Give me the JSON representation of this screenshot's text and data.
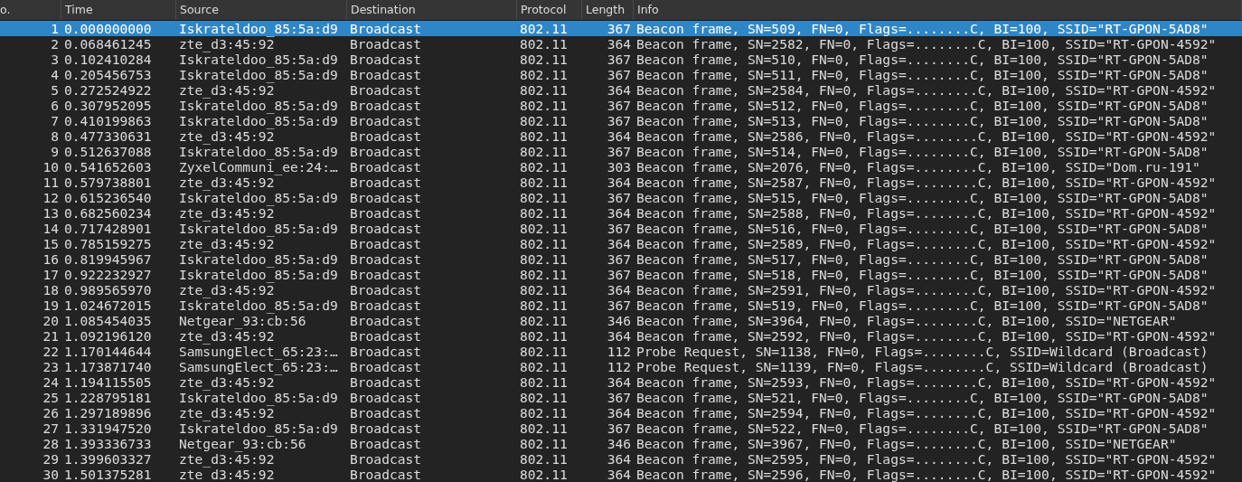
{
  "table": {
    "columns": [
      "o.",
      "Time",
      "Source",
      "Destination",
      "Protocol",
      "Length",
      "Info"
    ],
    "rows": [
      {
        "no": "1",
        "time": "0.000000000",
        "source": "Iskrateldoo_85:5a:d9",
        "destination": "Broadcast",
        "protocol": "802.11",
        "length": "367",
        "info": "Beacon frame, SN=509, FN=0, Flags=........C, BI=100, SSID=\"RT-GPON-5AD8\"",
        "selected": true
      },
      {
        "no": "2",
        "time": "0.068461245",
        "source": "zte_d3:45:92",
        "destination": "Broadcast",
        "protocol": "802.11",
        "length": "364",
        "info": "Beacon frame, SN=2582, FN=0, Flags=........C, BI=100, SSID=\"RT-GPON-4592\"",
        "selected": false
      },
      {
        "no": "3",
        "time": "0.102410284",
        "source": "Iskrateldoo_85:5a:d9",
        "destination": "Broadcast",
        "protocol": "802.11",
        "length": "367",
        "info": "Beacon frame, SN=510, FN=0, Flags=........C, BI=100, SSID=\"RT-GPON-5AD8\"",
        "selected": false
      },
      {
        "no": "4",
        "time": "0.205456753",
        "source": "Iskrateldoo_85:5a:d9",
        "destination": "Broadcast",
        "protocol": "802.11",
        "length": "367",
        "info": "Beacon frame, SN=511, FN=0, Flags=........C, BI=100, SSID=\"RT-GPON-5AD8\"",
        "selected": false
      },
      {
        "no": "5",
        "time": "0.272524922",
        "source": "zte_d3:45:92",
        "destination": "Broadcast",
        "protocol": "802.11",
        "length": "364",
        "info": "Beacon frame, SN=2584, FN=0, Flags=........C, BI=100, SSID=\"RT-GPON-4592\"",
        "selected": false
      },
      {
        "no": "6",
        "time": "0.307952095",
        "source": "Iskrateldoo_85:5a:d9",
        "destination": "Broadcast",
        "protocol": "802.11",
        "length": "367",
        "info": "Beacon frame, SN=512, FN=0, Flags=........C, BI=100, SSID=\"RT-GPON-5AD8\"",
        "selected": false
      },
      {
        "no": "7",
        "time": "0.410199863",
        "source": "Iskrateldoo_85:5a:d9",
        "destination": "Broadcast",
        "protocol": "802.11",
        "length": "367",
        "info": "Beacon frame, SN=513, FN=0, Flags=........C, BI=100, SSID=\"RT-GPON-5AD8\"",
        "selected": false
      },
      {
        "no": "8",
        "time": "0.477330631",
        "source": "zte_d3:45:92",
        "destination": "Broadcast",
        "protocol": "802.11",
        "length": "364",
        "info": "Beacon frame, SN=2586, FN=0, Flags=........C, BI=100, SSID=\"RT-GPON-4592\"",
        "selected": false
      },
      {
        "no": "9",
        "time": "0.512637088",
        "source": "Iskrateldoo_85:5a:d9",
        "destination": "Broadcast",
        "protocol": "802.11",
        "length": "367",
        "info": "Beacon frame, SN=514, FN=0, Flags=........C, BI=100, SSID=\"RT-GPON-5AD8\"",
        "selected": false
      },
      {
        "no": "10",
        "time": "0.541652603",
        "source": "ZyxelCommuni_ee:24:…",
        "destination": "Broadcast",
        "protocol": "802.11",
        "length": "303",
        "info": "Beacon frame, SN=2076, FN=0, Flags=........C, BI=100, SSID=\"Dom.ru-191\"",
        "selected": false
      },
      {
        "no": "11",
        "time": "0.579738801",
        "source": "zte_d3:45:92",
        "destination": "Broadcast",
        "protocol": "802.11",
        "length": "364",
        "info": "Beacon frame, SN=2587, FN=0, Flags=........C, BI=100, SSID=\"RT-GPON-4592\"",
        "selected": false
      },
      {
        "no": "12",
        "time": "0.615236540",
        "source": "Iskrateldoo_85:5a:d9",
        "destination": "Broadcast",
        "protocol": "802.11",
        "length": "367",
        "info": "Beacon frame, SN=515, FN=0, Flags=........C, BI=100, SSID=\"RT-GPON-5AD8\"",
        "selected": false
      },
      {
        "no": "13",
        "time": "0.682560234",
        "source": "zte_d3:45:92",
        "destination": "Broadcast",
        "protocol": "802.11",
        "length": "364",
        "info": "Beacon frame, SN=2588, FN=0, Flags=........C, BI=100, SSID=\"RT-GPON-4592\"",
        "selected": false
      },
      {
        "no": "14",
        "time": "0.717428901",
        "source": "Iskrateldoo_85:5a:d9",
        "destination": "Broadcast",
        "protocol": "802.11",
        "length": "367",
        "info": "Beacon frame, SN=516, FN=0, Flags=........C, BI=100, SSID=\"RT-GPON-5AD8\"",
        "selected": false
      },
      {
        "no": "15",
        "time": "0.785159275",
        "source": "zte_d3:45:92",
        "destination": "Broadcast",
        "protocol": "802.11",
        "length": "364",
        "info": "Beacon frame, SN=2589, FN=0, Flags=........C, BI=100, SSID=\"RT-GPON-4592\"",
        "selected": false
      },
      {
        "no": "16",
        "time": "0.819945967",
        "source": "Iskrateldoo_85:5a:d9",
        "destination": "Broadcast",
        "protocol": "802.11",
        "length": "367",
        "info": "Beacon frame, SN=517, FN=0, Flags=........C, BI=100, SSID=\"RT-GPON-5AD8\"",
        "selected": false
      },
      {
        "no": "17",
        "time": "0.922232927",
        "source": "Iskrateldoo_85:5a:d9",
        "destination": "Broadcast",
        "protocol": "802.11",
        "length": "367",
        "info": "Beacon frame, SN=518, FN=0, Flags=........C, BI=100, SSID=\"RT-GPON-5AD8\"",
        "selected": false
      },
      {
        "no": "18",
        "time": "0.989565970",
        "source": "zte_d3:45:92",
        "destination": "Broadcast",
        "protocol": "802.11",
        "length": "364",
        "info": "Beacon frame, SN=2591, FN=0, Flags=........C, BI=100, SSID=\"RT-GPON-4592\"",
        "selected": false
      },
      {
        "no": "19",
        "time": "1.024672015",
        "source": "Iskrateldoo_85:5a:d9",
        "destination": "Broadcast",
        "protocol": "802.11",
        "length": "367",
        "info": "Beacon frame, SN=519, FN=0, Flags=........C, BI=100, SSID=\"RT-GPON-5AD8\"",
        "selected": false
      },
      {
        "no": "20",
        "time": "1.085454035",
        "source": "Netgear_93:cb:56",
        "destination": "Broadcast",
        "protocol": "802.11",
        "length": "346",
        "info": "Beacon frame, SN=3964, FN=0, Flags=........C, BI=100, SSID=\"NETGEAR\"",
        "selected": false
      },
      {
        "no": "21",
        "time": "1.092196120",
        "source": "zte_d3:45:92",
        "destination": "Broadcast",
        "protocol": "802.11",
        "length": "364",
        "info": "Beacon frame, SN=2592, FN=0, Flags=........C, BI=100, SSID=\"RT-GPON-4592\"",
        "selected": false
      },
      {
        "no": "22",
        "time": "1.170144644",
        "source": "SamsungElect_65:23:…",
        "destination": "Broadcast",
        "protocol": "802.11",
        "length": "112",
        "info": "Probe Request, SN=1138, FN=0, Flags=........C, SSID=Wildcard (Broadcast)",
        "selected": false
      },
      {
        "no": "23",
        "time": "1.173871740",
        "source": "SamsungElect_65:23:…",
        "destination": "Broadcast",
        "protocol": "802.11",
        "length": "112",
        "info": "Probe Request, SN=1139, FN=0, Flags=........C, SSID=Wildcard (Broadcast)",
        "selected": false
      },
      {
        "no": "24",
        "time": "1.194115505",
        "source": "zte_d3:45:92",
        "destination": "Broadcast",
        "protocol": "802.11",
        "length": "364",
        "info": "Beacon frame, SN=2593, FN=0, Flags=........C, BI=100, SSID=\"RT-GPON-4592\"",
        "selected": false
      },
      {
        "no": "25",
        "time": "1.228795181",
        "source": "Iskrateldoo_85:5a:d9",
        "destination": "Broadcast",
        "protocol": "802.11",
        "length": "367",
        "info": "Beacon frame, SN=521, FN=0, Flags=........C, BI=100, SSID=\"RT-GPON-5AD8\"",
        "selected": false
      },
      {
        "no": "26",
        "time": "1.297189896",
        "source": "zte_d3:45:92",
        "destination": "Broadcast",
        "protocol": "802.11",
        "length": "364",
        "info": "Beacon frame, SN=2594, FN=0, Flags=........C, BI=100, SSID=\"RT-GPON-4592\"",
        "selected": false
      },
      {
        "no": "27",
        "time": "1.331947520",
        "source": "Iskrateldoo_85:5a:d9",
        "destination": "Broadcast",
        "protocol": "802.11",
        "length": "367",
        "info": "Beacon frame, SN=522, FN=0, Flags=........C, BI=100, SSID=\"RT-GPON-5AD8\"",
        "selected": false
      },
      {
        "no": "28",
        "time": "1.393336733",
        "source": "Netgear_93:cb:56",
        "destination": "Broadcast",
        "protocol": "802.11",
        "length": "346",
        "info": "Beacon frame, SN=3967, FN=0, Flags=........C, BI=100, SSID=\"NETGEAR\"",
        "selected": false
      },
      {
        "no": "29",
        "time": "1.399603327",
        "source": "zte_d3:45:92",
        "destination": "Broadcast",
        "protocol": "802.11",
        "length": "364",
        "info": "Beacon frame, SN=2595, FN=0, Flags=........C, BI=100, SSID=\"RT-GPON-4592\"",
        "selected": false
      },
      {
        "no": "30",
        "time": "1.501375281",
        "source": "zte_d3:45:92",
        "destination": "Broadcast",
        "protocol": "802.11",
        "length": "364",
        "info": "Beacon frame, SN=2596, FN=0, Flags=........C, BI=100, SSID=\"RT-GPON-4592\"",
        "selected": false
      }
    ]
  }
}
